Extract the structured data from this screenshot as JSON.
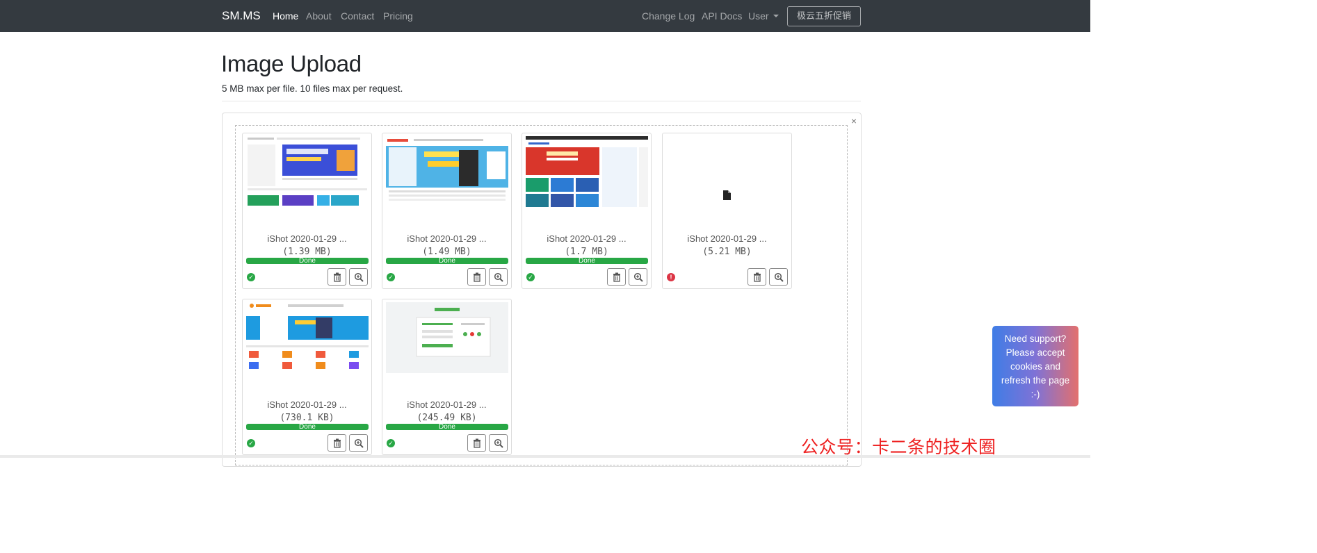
{
  "navbar": {
    "brand": "SM.MS",
    "left_links": [
      "Home",
      "About",
      "Contact",
      "Pricing"
    ],
    "right_links": [
      "Change Log",
      "API Docs"
    ],
    "user_menu": "User",
    "promo_button": "极云五折促销"
  },
  "header": {
    "title": "Image Upload",
    "subtitle": "5 MB max per file. 10 files max per request."
  },
  "upload": {
    "close_label": "×",
    "files": [
      {
        "name": "iShot 2020-01-29 ...",
        "size": "(1.39 MB)",
        "progress_label": "Done",
        "progress": 1.0,
        "status": "success"
      },
      {
        "name": "iShot 2020-01-29 ...",
        "size": "(1.49 MB)",
        "progress_label": "Done",
        "progress": 1.0,
        "status": "success"
      },
      {
        "name": "iShot 2020-01-29 ...",
        "size": "(1.7 MB)",
        "progress_label": "Done",
        "progress": 1.0,
        "status": "success"
      },
      {
        "name": "iShot 2020-01-29 ...",
        "size": "(5.21 MB)",
        "progress_label": "",
        "progress": 0,
        "status": "error"
      },
      {
        "name": "iShot 2020-01-29 ...",
        "size": "(730.1 KB)",
        "progress_label": "Done",
        "progress": 1.0,
        "status": "success"
      },
      {
        "name": "iShot 2020-01-29 ...",
        "size": "(245.49 KB)",
        "progress_label": "Done",
        "progress": 1.0,
        "status": "success"
      }
    ]
  },
  "support": {
    "lines": [
      "Need support?",
      "Please accept",
      "cookies and",
      "refresh the page",
      ":-)"
    ]
  },
  "watermark": "公众号：卡二条的技术圈",
  "colors": {
    "navbar_bg": "#343a40",
    "progress": "#28a745",
    "success": "#28a745",
    "error": "#dc3545",
    "watermark": "#ee2222"
  }
}
